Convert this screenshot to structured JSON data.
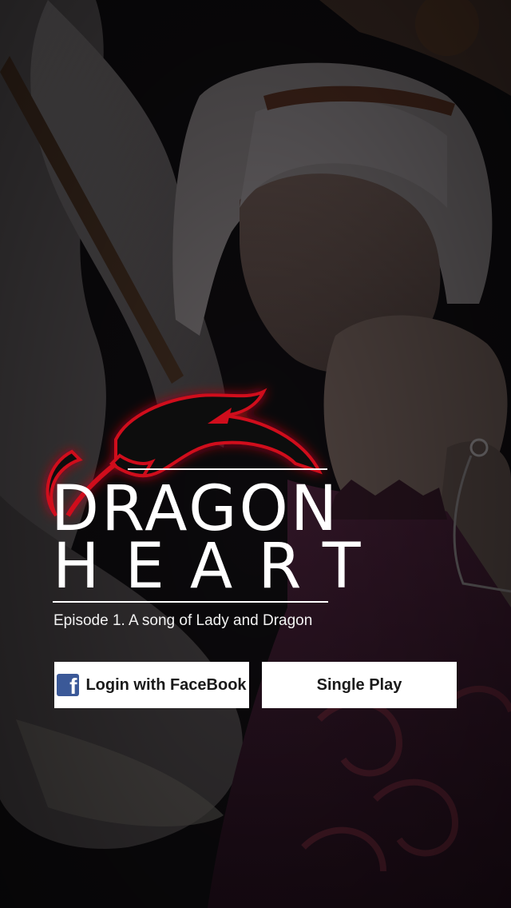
{
  "title": {
    "line1": "DRAGON",
    "line2": "HEART"
  },
  "subtitle": "Episode 1. A song of Lady and Dragon",
  "buttons": {
    "facebook_label": "Login with FaceBook",
    "single_play_label": "Single Play"
  },
  "icons": {
    "facebook": "facebook-f-icon",
    "logo": "dragon-emblem-icon"
  },
  "colors": {
    "logo_glow": "#d0101a",
    "button_bg": "#ffffff",
    "facebook_blue": "#3b5998",
    "text": "#ffffff"
  }
}
